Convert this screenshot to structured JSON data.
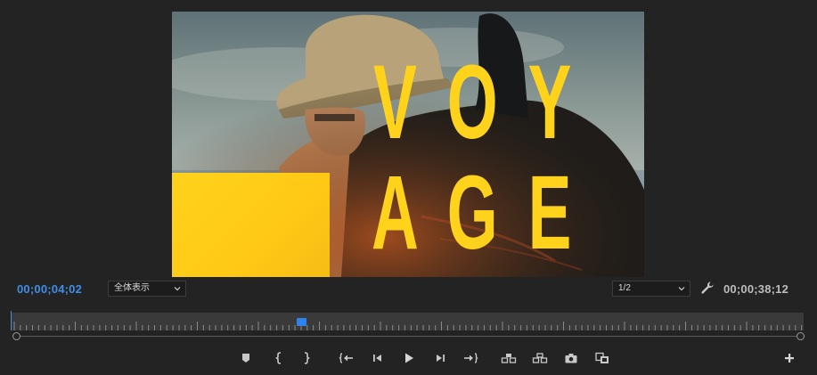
{
  "preview": {
    "title_line_1": [
      "V",
      "O",
      "Y"
    ],
    "title_line_2": [
      "A",
      "G",
      "E"
    ]
  },
  "controls": {
    "current_timecode": "00;00;04;02",
    "duration_timecode": "00;00;38;12",
    "zoom_level": "全体表示",
    "playback_resolution": "1/2"
  },
  "timeline": {
    "playhead_position_fraction": 0.037
  },
  "transport": {
    "buttons": [
      "add-marker-icon",
      "mark-in-icon",
      "mark-out-icon",
      "go-to-in-icon",
      "step-back-icon",
      "play-icon",
      "step-forward-icon",
      "go-to-out-icon",
      "lift-icon",
      "extract-icon",
      "export-frame-icon",
      "compare-view-icon",
      "button-editor-icon"
    ]
  },
  "colors": {
    "accent": "#3f8ee8",
    "title_yellow": "#ffd21c",
    "panel_bg": "#232323"
  }
}
